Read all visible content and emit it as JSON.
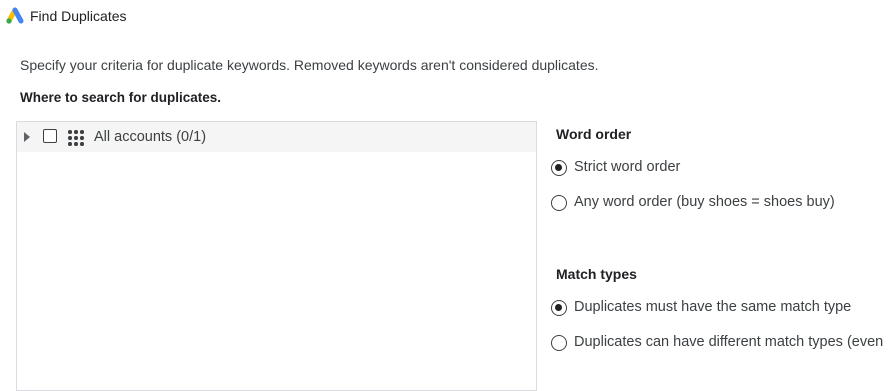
{
  "window": {
    "title": "Find Duplicates",
    "icon": "google-ads-logo-icon"
  },
  "description": "Specify your criteria for duplicate keywords. Removed keywords aren't considered duplicates.",
  "where_heading": "Where to search for duplicates.",
  "tree": {
    "root": {
      "label": "All accounts (0/1)",
      "checked": false,
      "expanded": false,
      "icon": "account-grid-icon"
    }
  },
  "word_order": {
    "heading": "Word order",
    "options": [
      {
        "label": "Strict word order",
        "selected": true
      },
      {
        "label": "Any word order (buy shoes = shoes buy)",
        "selected": false
      }
    ]
  },
  "match_types": {
    "heading": "Match types",
    "options": [
      {
        "label": "Duplicates must have the same match type",
        "selected": true
      },
      {
        "label": "Duplicates can have different match types (even",
        "selected": false
      }
    ]
  },
  "colors": {
    "logo_blue": "#4285F4",
    "logo_yellow": "#FBBC04",
    "logo_green": "#34A853"
  }
}
